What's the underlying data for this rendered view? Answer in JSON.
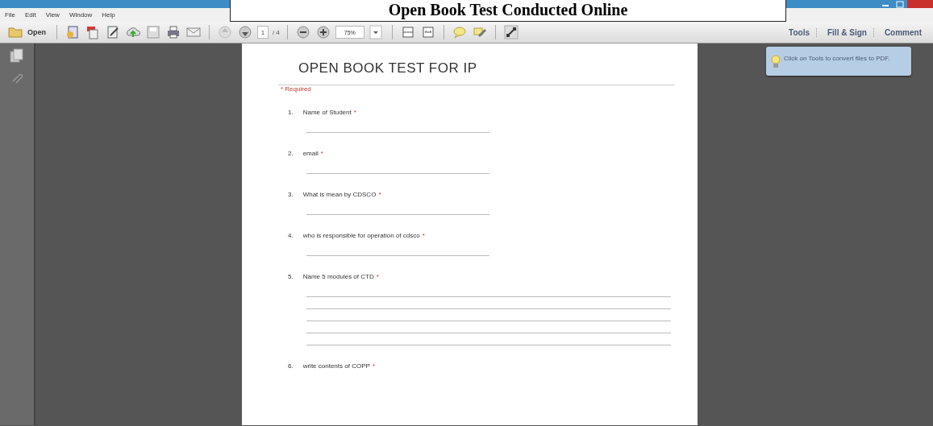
{
  "caption": "Open Book Test Conducted Online",
  "menu": [
    "File",
    "Edit",
    "View",
    "Window",
    "Help"
  ],
  "toolbar": {
    "open_label": "Open",
    "page_number": "1",
    "page_count": "/ 4",
    "zoom": "75%"
  },
  "panel_links": [
    "Tools",
    "Fill & Sign",
    "Comment"
  ],
  "tip": "Click on Tools to convert files to PDF.",
  "document": {
    "title": "OPEN BOOK TEST FOR IP",
    "required_note": "* Required",
    "questions": [
      {
        "number": "1.",
        "text": "Name of Student",
        "required_mark": "*",
        "kind": "short"
      },
      {
        "number": "2.",
        "text": "email",
        "required_mark": "*",
        "kind": "short"
      },
      {
        "number": "3.",
        "text": "What is mean by CDSCO",
        "required_mark": "*",
        "kind": "short"
      },
      {
        "number": "4.",
        "text": "who is responsible for operation of cdsco",
        "required_mark": "*",
        "kind": "short"
      },
      {
        "number": "5.",
        "text": "Name 5 modules of CTD",
        "required_mark": "*",
        "kind": "paragraph"
      },
      {
        "number": "6.",
        "text": "write contents of COPP",
        "required_mark": "*",
        "kind": "none"
      }
    ]
  }
}
